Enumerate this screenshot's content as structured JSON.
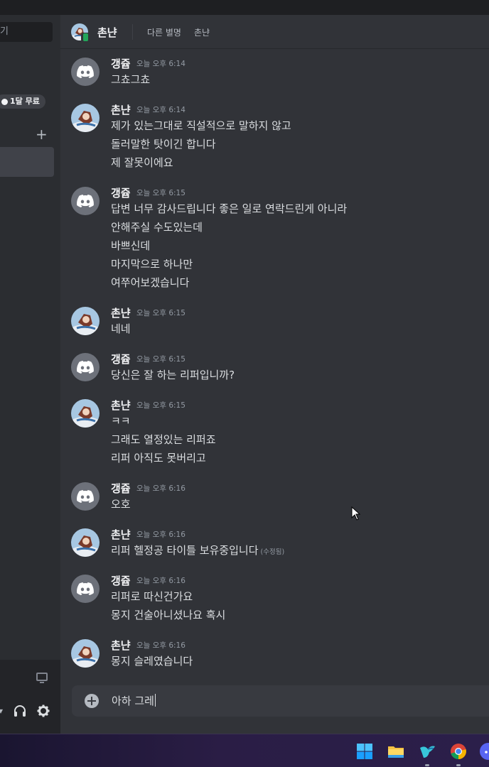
{
  "sidebar": {
    "search_fragment": "기",
    "nitro_badge": "1달 무료",
    "add_label": "+"
  },
  "header": {
    "name": "촌냔",
    "alias_label": "다른 별명",
    "alias_value": "촌냔"
  },
  "messages": [
    {
      "author": "갱쥽",
      "avatar": "discord-logo-icon",
      "time": "오늘 오후 6:14",
      "lines": [
        "그쵸그쵸"
      ]
    },
    {
      "author": "촌냔",
      "avatar": "anime-character-avatar",
      "time": "오늘 오후 6:14",
      "lines": [
        "제가 있는그대로 직설적으로 말하지 않고",
        "돌러말한 탓이긴 합니다",
        "제 잘못이에요"
      ]
    },
    {
      "author": "갱쥽",
      "avatar": "discord-logo-icon",
      "time": "오늘 오후 6:15",
      "lines": [
        "답변 너무 감사드립니다 좋은 일로 연락드린게 아니라",
        "안해주실 수도있는데",
        "바쁘신데",
        "마지막으로 하나만",
        "여쭈어보겠습니다"
      ]
    },
    {
      "author": "촌냔",
      "avatar": "anime-character-avatar",
      "time": "오늘 오후 6:15",
      "lines": [
        "네네"
      ]
    },
    {
      "author": "갱쥽",
      "avatar": "discord-logo-icon",
      "time": "오늘 오후 6:15",
      "lines": [
        "당신은 잘 하는 리퍼입니까?"
      ]
    },
    {
      "author": "촌냔",
      "avatar": "anime-character-avatar",
      "time": "오늘 오후 6:15",
      "lines": [
        "ㅋㅋ",
        "그래도 열정있는 리퍼죠",
        "리퍼 아직도 못버리고"
      ]
    },
    {
      "author": "갱쥽",
      "avatar": "discord-logo-icon",
      "time": "오늘 오후 6:16",
      "lines": [
        "오호"
      ]
    },
    {
      "author": "촌냔",
      "avatar": "anime-character-avatar",
      "time": "오늘 오후 6:16",
      "lines": [
        "리퍼 헬정공 타이틀 보유중입니다"
      ],
      "edited": "(수정됨)"
    },
    {
      "author": "갱쥽",
      "avatar": "discord-logo-icon",
      "time": "오늘 오후 6:16",
      "lines": [
        "리퍼로 따신건가요",
        "몽지 건술아니셨나요 혹시"
      ]
    },
    {
      "author": "촌냔",
      "avatar": "anime-character-avatar",
      "time": "오늘 오후 6:16",
      "lines": [
        "몽지 슬레였습니다"
      ]
    }
  ],
  "composer": {
    "text": "아하 그레"
  },
  "taskbar": {
    "icons": [
      "windows-start-icon",
      "file-explorer-icon",
      "bird-app-icon",
      "chrome-icon",
      "discord-icon"
    ]
  },
  "colors": {
    "background": "#313338",
    "sidebar": "#2b2d31",
    "discord_avatar": "#6d717a",
    "online_green": "#23a55a"
  }
}
